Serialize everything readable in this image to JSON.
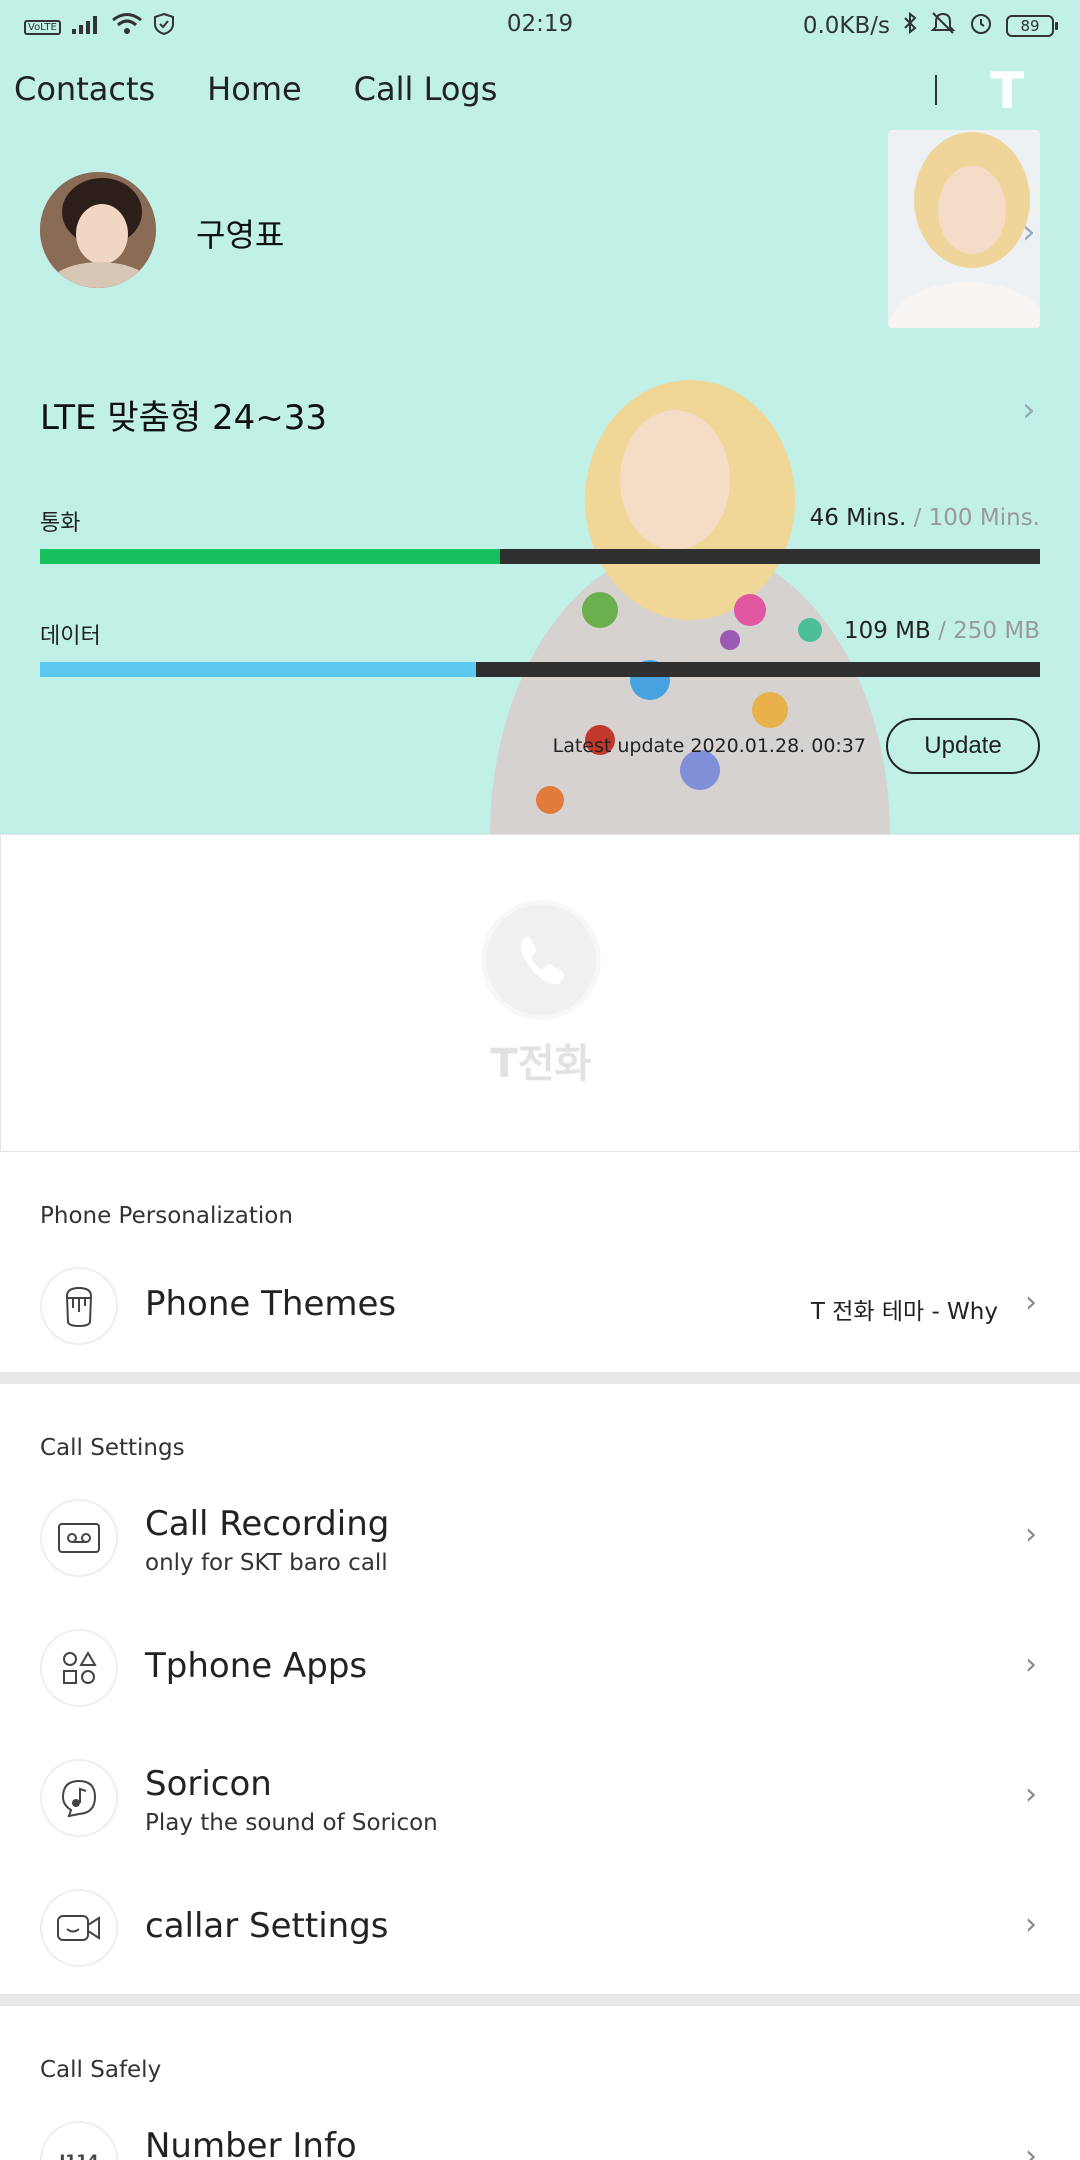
{
  "status_bar": {
    "network": "VoLTE",
    "clock": "02:19",
    "speed": "0.0KB/s",
    "battery": "89"
  },
  "nav": {
    "contacts": "Contacts",
    "home": "Home",
    "call_logs": "Call Logs",
    "logo": "T"
  },
  "profile": {
    "name": "구영표"
  },
  "plan": {
    "name": "LTE 맞춤형 24~33",
    "call": {
      "label": "통화",
      "used": "46 Mins.",
      "total": "/ 100 Mins.",
      "fraction": 0.46,
      "color": "#15c15d"
    },
    "data": {
      "label": "데이터",
      "used": "109 MB",
      "total": "/ 250 MB",
      "fraction": 0.436,
      "color": "#5bc8f2"
    },
    "latest_update": "Latest update 2020.01.28.   00:37",
    "update_button": "Update"
  },
  "banner": {
    "text": "T전화"
  },
  "sections": {
    "personalization": {
      "title": "Phone Personalization",
      "themes": {
        "title": "Phone Themes",
        "value": "T 전화 테마 - Why"
      }
    },
    "call_settings": {
      "title": "Call Settings",
      "recording": {
        "title": "Call Recording",
        "subtitle": "only for SKT baro call"
      },
      "apps": {
        "title": "Tphone Apps"
      },
      "soricon": {
        "title": "Soricon",
        "subtitle": "Play the sound of Soricon"
      },
      "callar": {
        "title": "callar Settings"
      }
    },
    "call_safely": {
      "title": "Call Safely",
      "number_info": {
        "title": "Number Info",
        "icon_text": "I114"
      }
    }
  },
  "colors": {
    "header_bg": "#c0f0e6",
    "call_bar": "#15c15d",
    "data_bar": "#5bc8f2",
    "track": "#2f2f2f"
  }
}
